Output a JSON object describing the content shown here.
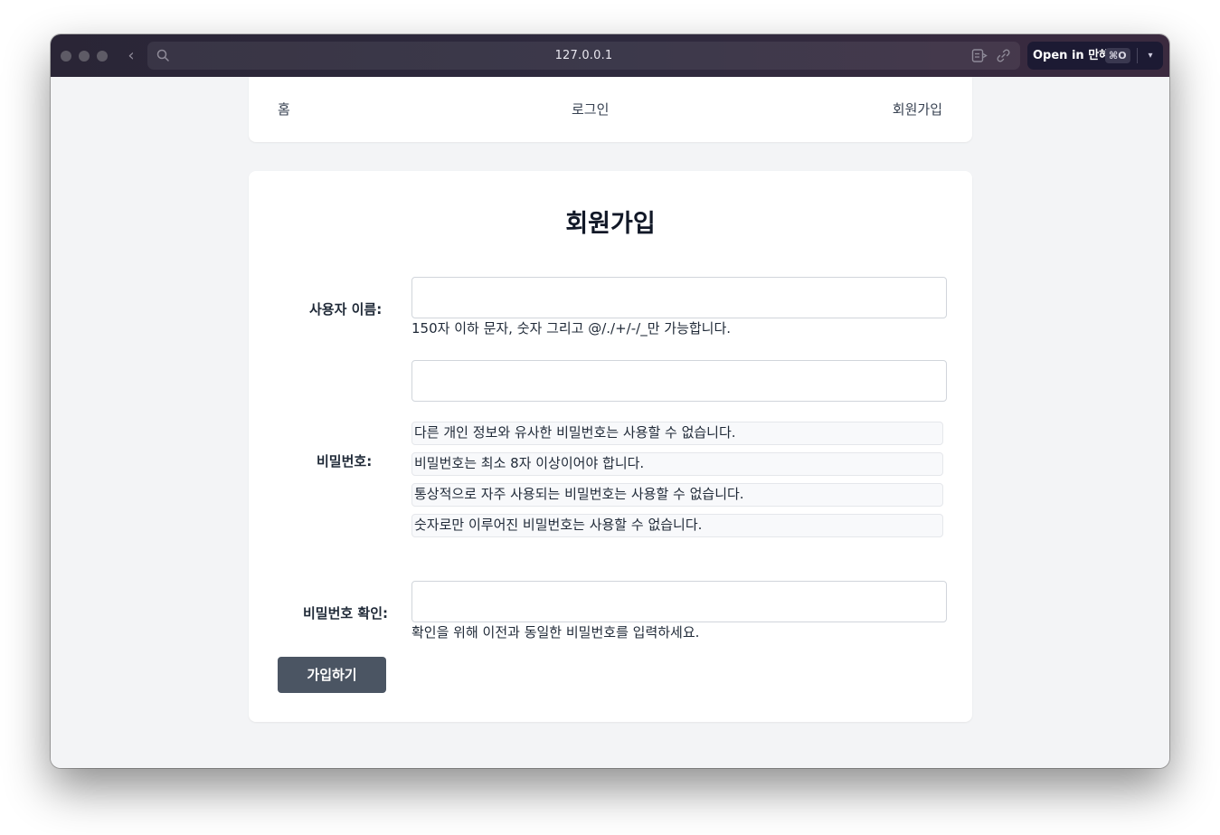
{
  "browser": {
    "url": "127.0.0.1",
    "open_in_label": "Open in 만혜",
    "open_in_shortcut": "⌘O"
  },
  "nav": {
    "home": "홈",
    "login": "로그인",
    "signup": "회원가입"
  },
  "form": {
    "title": "회원가입",
    "username": {
      "label": "사용자 이름:",
      "value": "",
      "help": "150자 이하 문자, 숫자 그리고 @/./+/-/_만 가능합니다."
    },
    "password": {
      "label": "비밀번호:",
      "value": "",
      "rules": [
        "다른 개인 정보와 유사한 비밀번호는 사용할 수 없습니다.",
        "비밀번호는 최소 8자 이상이어야 합니다.",
        "통상적으로 자주 사용되는 비밀번호는 사용할 수 없습니다.",
        "숫자로만 이루어진 비밀번호는 사용할 수 없습니다."
      ]
    },
    "password_confirm": {
      "label": "비밀번호 확인:",
      "value": "",
      "help": "확인을 위해 이전과 동일한 비밀번호를 입력하세요."
    },
    "submit_label": "가입하기"
  }
}
